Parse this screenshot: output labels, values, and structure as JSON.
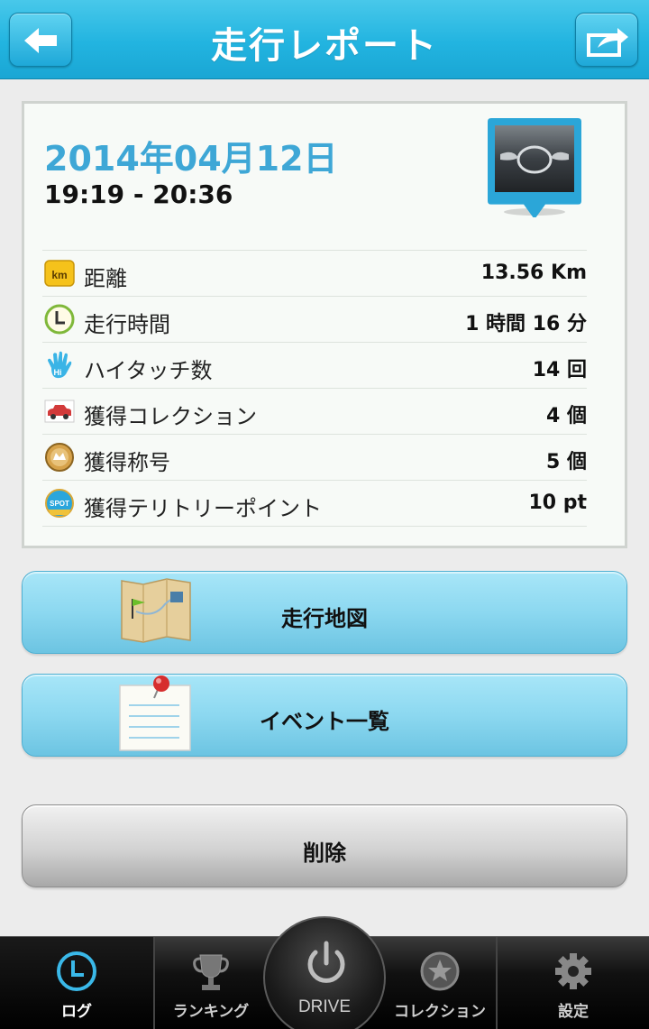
{
  "header": {
    "title": "走行レポート",
    "back_icon": "arrow-left-icon",
    "share_icon": "share-icon"
  },
  "report": {
    "date": "2014年04月12日",
    "time_range": "19:19 - 20:36",
    "thumbnail_icon": "car-badge-pin-icon",
    "stats": [
      {
        "icon": "km-icon",
        "label": "距離",
        "value": "13.56 Km"
      },
      {
        "icon": "clock-icon",
        "label": "走行時間",
        "value": "1 時間 16 分"
      },
      {
        "icon": "hi-touch-hand-icon",
        "label": "ハイタッチ数",
        "value": "14 回"
      },
      {
        "icon": "car-icon",
        "label": "獲得コレクション",
        "value": "4 個"
      },
      {
        "icon": "title-medal-icon",
        "label": "獲得称号",
        "value": "5 個"
      },
      {
        "icon": "spot-icon",
        "label": "獲得テリトリーポイント",
        "value": "10 pt"
      }
    ]
  },
  "actions": {
    "map_label": "走行地図",
    "events_label": "イベント一覧",
    "delete_label": "削除"
  },
  "tabbar": {
    "log": "ログ",
    "ranking": "ランキング",
    "drive": "DRIVE",
    "collection": "コレクション",
    "settings": "設定"
  },
  "colors": {
    "accent": "#22b4e0",
    "date": "#3ea7d6",
    "button_blue": "#8cd8f0"
  }
}
